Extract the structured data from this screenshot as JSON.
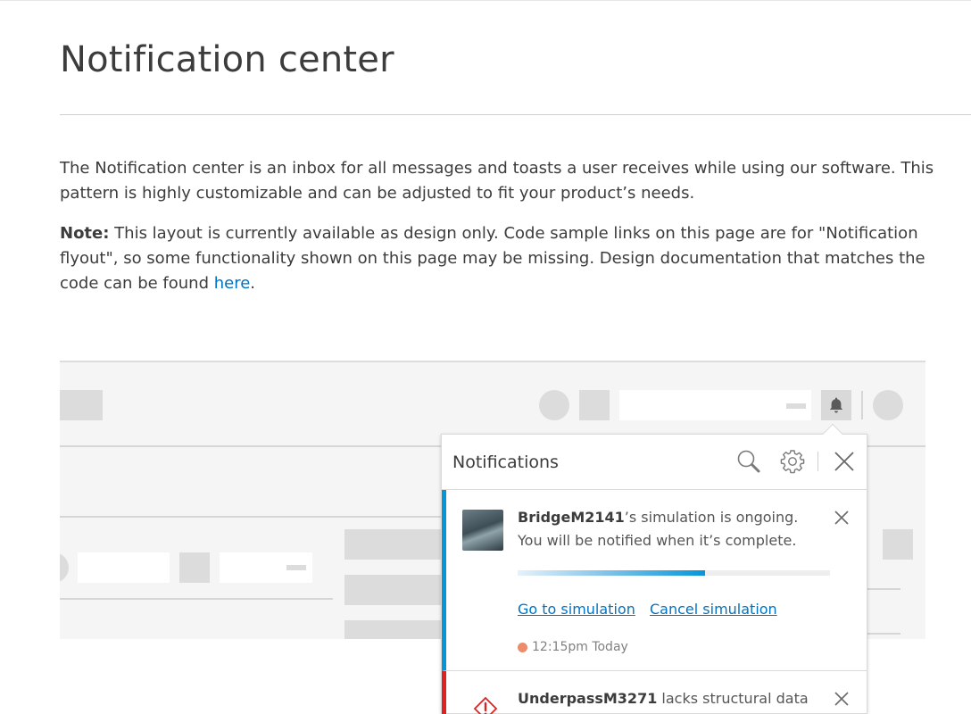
{
  "page": {
    "title": "Notification center",
    "intro": "The Notification center is an inbox for all messages and toasts a user receives while using our software. This pattern is highly customizable and can be adjusted to fit your product’s needs.",
    "note_label": "Note:",
    "note_text": " This layout is currently available as design only. Code sample links on this page are for \"Notification flyout\", so some functionality shown on this page may be missing. Design documentation that matches the code can be found ",
    "note_link": "here",
    "note_end": "."
  },
  "flyout": {
    "title": "Notifications",
    "icons": [
      "search-icon",
      "gear-icon",
      "close-icon"
    ],
    "notifications": [
      {
        "name": "BridgeM2141",
        "message": "’s simulation is ongoing. You will be notified when it’s complete.",
        "progress": 0.6,
        "actions": [
          "Go to simulation",
          "Cancel simulation"
        ],
        "time": "12:15pm Today",
        "status_color": "#eb8d6b",
        "accent": "#0696d7"
      },
      {
        "name": "UnderpassM3271",
        "message": " lacks structural data",
        "icon": "warning-icon",
        "accent": "#dd2222"
      }
    ]
  },
  "colors": {
    "link": "#0073c2",
    "text": "#3c3c3c",
    "placeholder": "#dcdcdc"
  }
}
